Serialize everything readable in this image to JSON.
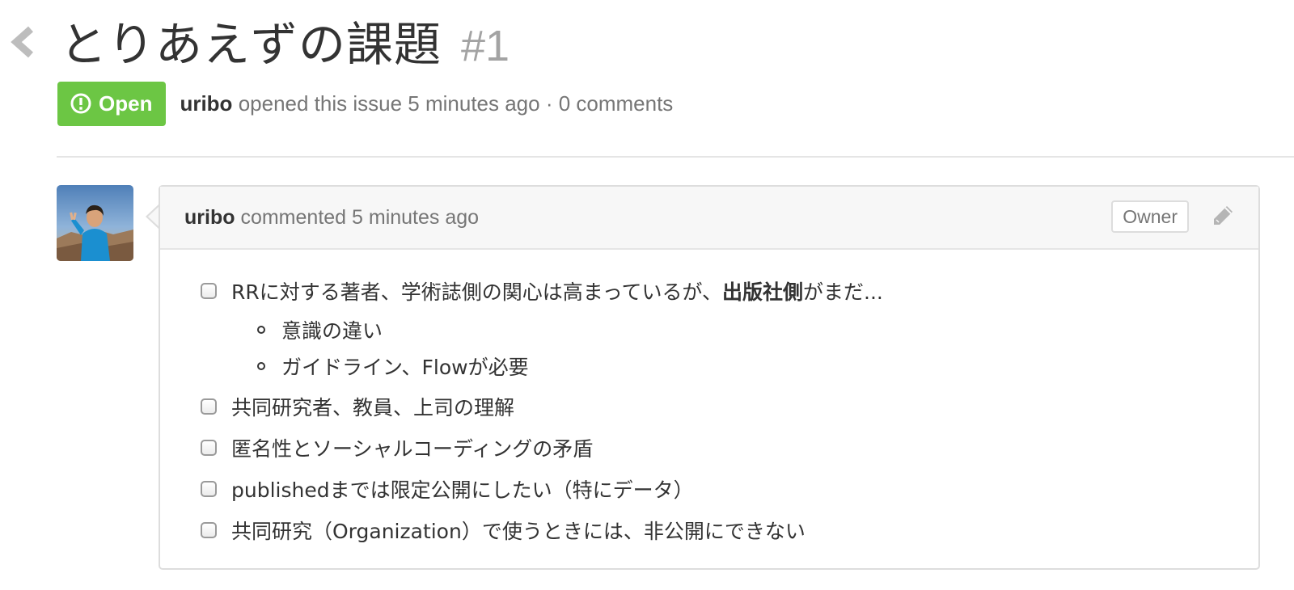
{
  "issue": {
    "title": "とりあえずの課題",
    "number": "#1",
    "status": "Open",
    "author": "uribo",
    "meta": "opened this issue 5 minutes ago · 0 comments"
  },
  "comment": {
    "author": "uribo",
    "meta": "commented 5 minutes ago",
    "role_badge": "Owner",
    "tasks": [
      {
        "text_before": "RRに対する著者、学術誌側の関心は高まっているが、",
        "text_bold": "出版社側",
        "text_after": "がまだ...",
        "subitems": [
          "意識の違い",
          "ガイドライン、Flowが必要"
        ]
      },
      {
        "text": "共同研究者、教員、上司の理解"
      },
      {
        "text": "匿名性とソーシャルコーディングの矛盾"
      },
      {
        "text": "publishedまでは限定公開にしたい（特にデータ）"
      },
      {
        "text": "共同研究（Organization）で使うときには、非公開にできない"
      }
    ]
  },
  "icons": {
    "back": "chevron-left-icon",
    "status": "issue-opened-icon",
    "edit": "pencil-icon"
  },
  "colors": {
    "open_badge": "#6cc644",
    "number": "#a3a3a3",
    "muted_text": "#767676"
  }
}
